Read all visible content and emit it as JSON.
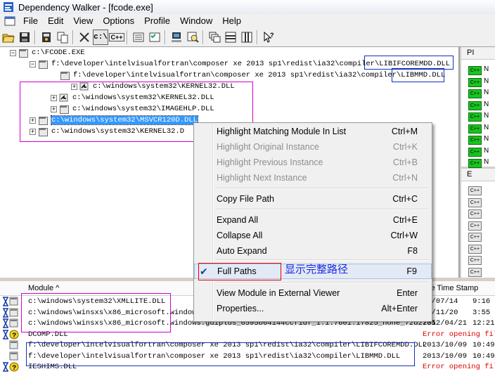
{
  "window": {
    "title": "Dependency Walker - [fcode.exe]"
  },
  "menus": [
    "File",
    "Edit",
    "View",
    "Options",
    "Profile",
    "Window",
    "Help"
  ],
  "toolbar": {
    "btn_c_label": "c:\\",
    "btn_cpp_label": "C++"
  },
  "tree": {
    "rows": [
      {
        "text": "c:\\FCODE.EXE"
      },
      {
        "text": "f:\\developer\\intelvisualfortran\\composer xe 2013 sp1\\redist\\ia32\\compiler\\LIBIFCOREMDD.DLL"
      },
      {
        "text": "f:\\developer\\intelvisualfortran\\composer xe 2013 sp1\\redist\\ia32\\compiler\\LIBMMD.DLL"
      },
      {
        "text": "c:\\windows\\system32\\KERNEL32.DLL"
      },
      {
        "text": "c:\\windows\\system32\\KERNEL32.DLL"
      },
      {
        "text": "c:\\windows\\system32\\IMAGEHLP.DLL"
      },
      {
        "text": "c:\\windows\\system32\\MSVCR120D.DLL"
      },
      {
        "text": "c:\\windows\\system32\\KERNEL32.D"
      }
    ]
  },
  "right_top": {
    "header": "PI",
    "badge": "C++",
    "row_letters": [
      "N",
      "N",
      "N",
      "N",
      "N",
      "N",
      "N",
      "N",
      "N",
      "N"
    ]
  },
  "right_bottom": {
    "header": "E",
    "badge": "C++"
  },
  "context_menu": {
    "items": [
      {
        "label": "Highlight Matching Module In List",
        "shortcut": "Ctrl+M",
        "enabled": true
      },
      {
        "label": "Highlight Original Instance",
        "shortcut": "Ctrl+K",
        "enabled": false
      },
      {
        "label": "Highlight Previous Instance",
        "shortcut": "Ctrl+B",
        "enabled": false
      },
      {
        "label": "Highlight Next Instance",
        "shortcut": "Ctrl+N",
        "enabled": false
      },
      {
        "label": "Copy File Path",
        "shortcut": "Ctrl+C",
        "enabled": true
      },
      {
        "label": "Expand All",
        "shortcut": "Ctrl+E",
        "enabled": true
      },
      {
        "label": "Collapse All",
        "shortcut": "Ctrl+W",
        "enabled": true
      },
      {
        "label": "Auto Expand",
        "shortcut": "F8",
        "enabled": true
      },
      {
        "label": "Full Paths",
        "shortcut": "F9",
        "enabled": true,
        "checked": true
      },
      {
        "label": "View Module in External Viewer",
        "shortcut": "Enter",
        "enabled": true
      },
      {
        "label": "Properties...",
        "shortcut": "Alt+Enter",
        "enabled": true
      }
    ]
  },
  "annotation": {
    "full_paths_note": "显示完整路径"
  },
  "module_list": {
    "columns": {
      "module": "Module ^",
      "timestamp": "le Time Stamp"
    },
    "rows": [
      {
        "module": "c:\\windows\\system32\\XMLLITE.DLL",
        "date": "09/07/14",
        "time": "9:16"
      },
      {
        "module": "c:\\windows\\winsxs\\x86_microsoft.windows",
        "date": "10/11/20",
        "time": "3:55"
      },
      {
        "module": "c:\\windows\\winsxs\\x86_microsoft.windows.gdiplus_6595b64144ccf1df_1.1.7601.17825_none_72d2735",
        "date": "2012/04/21",
        "time": "12:21"
      },
      {
        "module": "DCOMP.DLL",
        "error": "Error opening fil"
      },
      {
        "module": "f:\\developer\\intelvisualfortran\\composer xe 2013 sp1\\redist\\ia32\\compiler\\LIBIFCOREMDD.DLL",
        "date": "2013/10/09",
        "time": "10:49"
      },
      {
        "module": "f:\\developer\\intelvisualfortran\\composer xe 2013 sp1\\redist\\ia32\\compiler\\LIBMMD.DLL",
        "date": "2013/10/09",
        "time": "10:49"
      },
      {
        "module": "IESHIMS.DLL",
        "error": "Error opening fil"
      }
    ]
  },
  "colors": {
    "selection": "#3399ff",
    "error": "#e00000",
    "pink_box": "#d000d0",
    "blue_box": "#1030c0",
    "note": "#1c2be0"
  }
}
